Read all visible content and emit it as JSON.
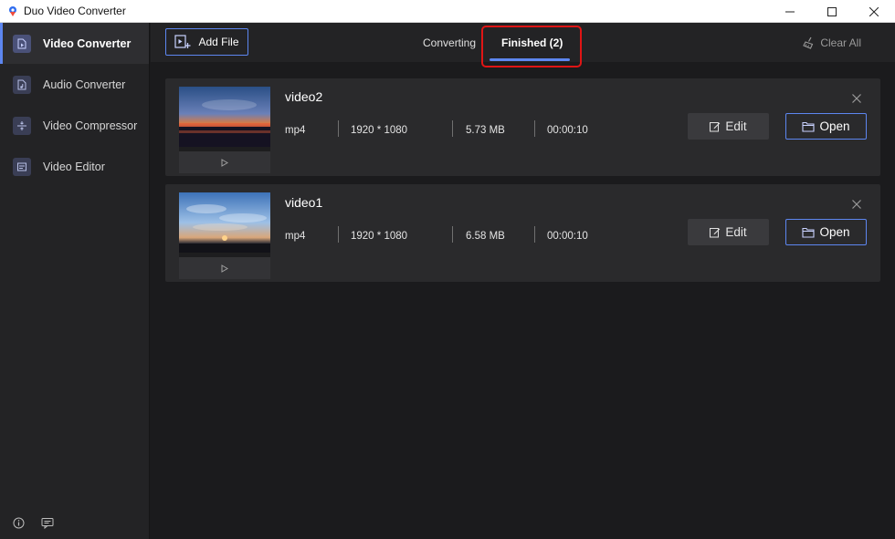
{
  "window": {
    "title": "Duo Video Converter",
    "icons": {
      "app": "app-logo-icon",
      "minimize": "minimize-icon",
      "maximize": "maximize-icon",
      "close": "close-icon"
    }
  },
  "sidebar": {
    "items": [
      {
        "label": "Video Converter",
        "icon": "video-converter-icon",
        "active": true
      },
      {
        "label": "Audio Converter",
        "icon": "audio-converter-icon",
        "active": false
      },
      {
        "label": "Video Compressor",
        "icon": "video-compressor-icon",
        "active": false
      },
      {
        "label": "Video Editor",
        "icon": "video-editor-icon",
        "active": false
      }
    ],
    "footer_icons": [
      "info-icon",
      "feedback-icon"
    ]
  },
  "toolbar": {
    "add_file_label": "Add File",
    "tabs": [
      {
        "label": "Converting",
        "active": false
      },
      {
        "label": "Finished (2)",
        "active": true
      }
    ],
    "clear_all_label": "Clear All"
  },
  "files": [
    {
      "name": "video2",
      "format": "mp4",
      "resolution": "1920 * 1080",
      "size": "5.73 MB",
      "duration": "00:00:10",
      "edit_label": "Edit",
      "open_label": "Open"
    },
    {
      "name": "video1",
      "format": "mp4",
      "resolution": "1920 * 1080",
      "size": "6.58 MB",
      "duration": "00:00:10",
      "edit_label": "Edit",
      "open_label": "Open"
    }
  ],
  "colors": {
    "accent": "#5d86f0",
    "highlight": "#e01515",
    "background": "#1b1b1d",
    "card": "#2a2a2c",
    "sidebar": "#232325"
  }
}
